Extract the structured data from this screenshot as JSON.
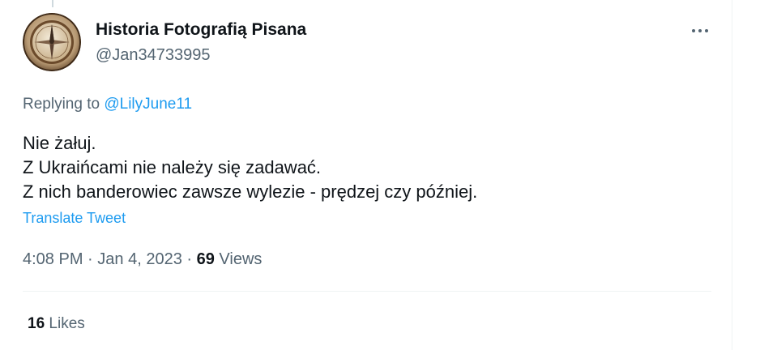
{
  "author": {
    "display_name": "Historia Fotografią Pisana",
    "handle": "@Jan34733995",
    "avatar_icon": "compass-avatar-icon"
  },
  "reply": {
    "prefix": "Replying to",
    "mention": "@LilyJune11"
  },
  "tweet": {
    "lines": [
      "Nie żałuj.",
      "Z Ukraińcami nie należy się zadawać.",
      "Z nich banderowiec zawsze wylezie - prędzej czy później."
    ],
    "translate_label": "Translate Tweet"
  },
  "meta": {
    "time": "4:08 PM",
    "date": "Jan 4, 2023",
    "separator": "·",
    "views_count": "69",
    "views_label": "Views"
  },
  "stats": {
    "likes_count": "16",
    "likes_label": "Likes"
  },
  "colors": {
    "link": "#1d9bf0",
    "secondary_text": "#536471",
    "primary_text": "#0f1419",
    "divider": "#eff3f4"
  },
  "icons": {
    "more": "more-options-icon"
  }
}
